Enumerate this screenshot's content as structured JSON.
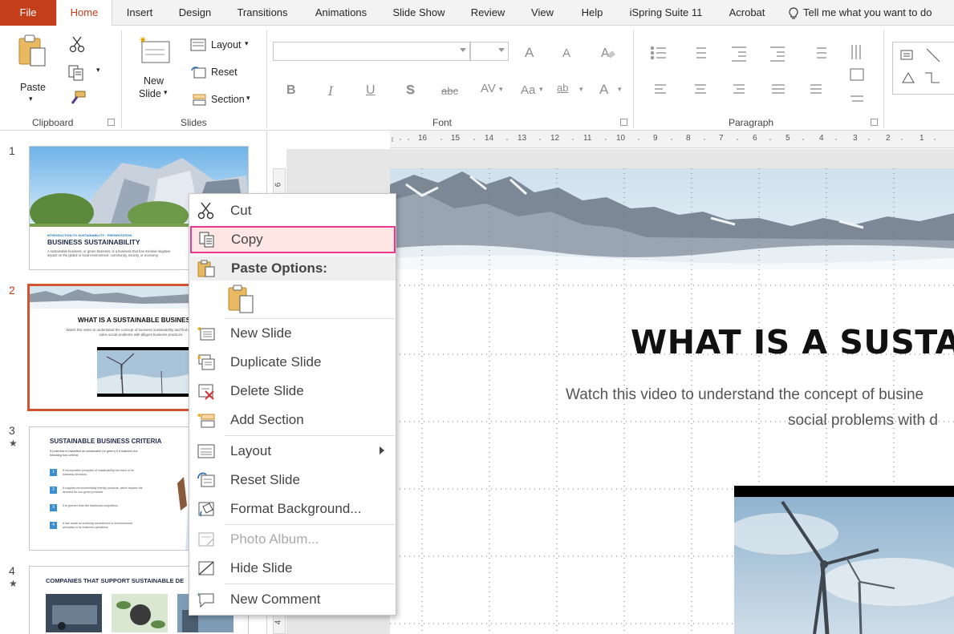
{
  "menubar": {
    "file": "File",
    "tabs": [
      "Home",
      "Insert",
      "Design",
      "Transitions",
      "Animations",
      "Slide Show",
      "Review",
      "View",
      "Help",
      "iSpring Suite 11",
      "Acrobat"
    ],
    "tell_me": "Tell me what you want to do",
    "active_tab": "Home"
  },
  "ribbon": {
    "clipboard": {
      "paste": "Paste",
      "group": "Clipboard"
    },
    "slides": {
      "new_slide_1": "New",
      "new_slide_2": "Slide",
      "layout": "Layout",
      "reset": "Reset",
      "section": "Section",
      "group": "Slides"
    },
    "font": {
      "group": "Font",
      "bold": "B",
      "italic": "I",
      "underline": "U",
      "shadow": "S",
      "strike": "abc",
      "spacing": "AV",
      "case": "Aa",
      "highlight": "ab",
      "color": "A",
      "grow": "A",
      "shrink": "A"
    },
    "paragraph": {
      "group": "Paragraph"
    }
  },
  "ruler": {
    "h_labels": [
      "16",
      "15",
      "14",
      "13",
      "12",
      "11",
      "10",
      "9",
      "8",
      "7",
      "6",
      "5",
      "4",
      "3",
      "2",
      "1"
    ],
    "v_labels": [
      "6",
      "4"
    ]
  },
  "thumbnails": [
    {
      "num": "1",
      "title": "BUSINESS SUSTAINABILITY",
      "kicker": "INTRODUCTION TO SUSTAINABILITY · PRESENTATION",
      "body": "A sustainable business, or green business, is a business that has minimal negative impact on the global or local environment, community, society, or economy."
    },
    {
      "num": "2",
      "title": "WHAT IS A SUSTAINABLE BUSINESS?",
      "body": "Watch this video to understand the concept of business sustainability and find out how it helps to solve social problems with diligent business practices.",
      "selected": true
    },
    {
      "num": "3",
      "title": "SUSTAINABLE BUSINESS CRITERIA",
      "intro": "A business is classified as sustainable (or green) if it matches the following four criteria:",
      "items": [
        "It incorporates principles of sustainability into each of its business decisions",
        "It supplies environmentally friendly products, which replace the demand for non-green products",
        "It is greener than the traditional competition",
        "It has made an enduring commitment to environmental principles in its business operations"
      ],
      "star": "★"
    },
    {
      "num": "4",
      "title": "COMPANIES THAT SUPPORT SUSTAINABLE DE",
      "star": "★"
    }
  ],
  "slide": {
    "title": "WHAT IS A SUSTA",
    "subtitle_line1": "Watch this video to understand the concept of busine",
    "subtitle_line2": "social problems with d"
  },
  "context_menu": {
    "cut": "Cut",
    "copy": "Copy",
    "paste_options": "Paste Options:",
    "new_slide": "New Slide",
    "duplicate_slide": "Duplicate Slide",
    "delete_slide": "Delete Slide",
    "add_section": "Add Section",
    "layout": "Layout",
    "reset_slide": "Reset Slide",
    "format_background": "Format Background...",
    "photo_album": "Photo Album...",
    "hide_slide": "Hide Slide",
    "new_comment": "New Comment"
  },
  "colors": {
    "accent": "#c43e1c",
    "selection_border": "#d35230",
    "menu_highlight": "#fde6e3",
    "menu_highlight_outline": "#e8398c",
    "thumb_number_bg": "#3b8fd0"
  }
}
